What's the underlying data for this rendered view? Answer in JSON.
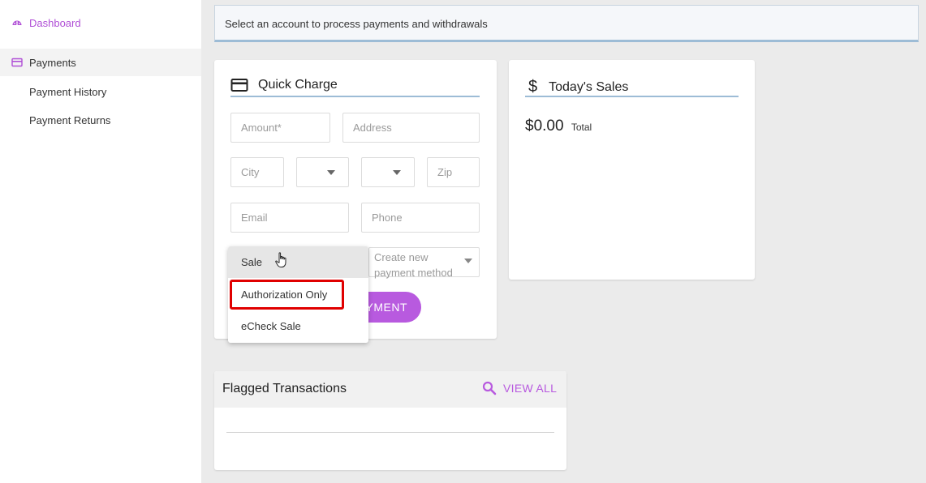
{
  "sidebar": {
    "dashboard": "Dashboard",
    "payments": "Payments",
    "payment_history": "Payment History",
    "payment_returns": "Payment Returns"
  },
  "banner": {
    "text": "Select an account to process payments and withdrawals"
  },
  "quick_charge": {
    "title": "Quick Charge",
    "fields": {
      "amount": "Amount*",
      "address": "Address",
      "city": "City",
      "zip": "Zip",
      "email": "Email",
      "phone": "Phone",
      "payment_method": "Create new payment method"
    },
    "button_visible_text": "YMENT"
  },
  "transaction_menu": {
    "options": [
      "Sale",
      "Authorization Only",
      "eCheck Sale"
    ],
    "hovered": "Sale",
    "highlighted": "Authorization Only"
  },
  "todays_sales": {
    "title": "Today's Sales",
    "amount": "$0.00",
    "amount_label": "Total"
  },
  "flagged": {
    "title": "Flagged Transactions",
    "view_all": "VIEW ALL"
  },
  "colors": {
    "accent": "#b85adf",
    "rule": "#9dbcd6",
    "highlight": "#e00000"
  }
}
